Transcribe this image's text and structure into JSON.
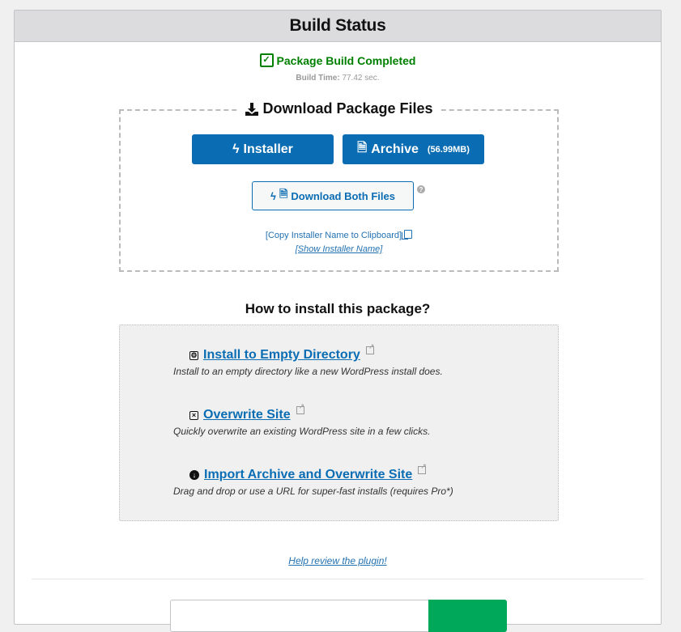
{
  "header": {
    "title": "Build Status"
  },
  "status": {
    "message": "Package Build Completed",
    "build_time_label": "Build Time:",
    "build_time_value": "77.42 sec.",
    "color": "#008000"
  },
  "download": {
    "legend": "Download Package Files",
    "installer_label": "Installer",
    "archive_label": "Archive",
    "archive_size": "(56.99MB)",
    "both_label": "Download Both Files",
    "help_glyph": "?",
    "copy_label": "[Copy Installer Name to Clipboard]",
    "show_label": "[Show Installer Name]",
    "accent": "#0a6db4"
  },
  "howto": {
    "title": "How to install this package?",
    "items": [
      {
        "icon": "save-icon",
        "label": "Install to Empty Directory",
        "desc": "Install to an empty directory like a new WordPress install does."
      },
      {
        "icon": "close-box-icon",
        "label": "Overwrite Site",
        "desc": "Quickly overwrite an existing WordPress site in a few clicks."
      },
      {
        "icon": "download-circle-icon",
        "label": "Import Archive and Overwrite Site",
        "desc": "Drag and drop or use a URL for super-fast installs (requires Pro*)"
      }
    ]
  },
  "footer": {
    "review_label": "Help review the plugin!"
  }
}
